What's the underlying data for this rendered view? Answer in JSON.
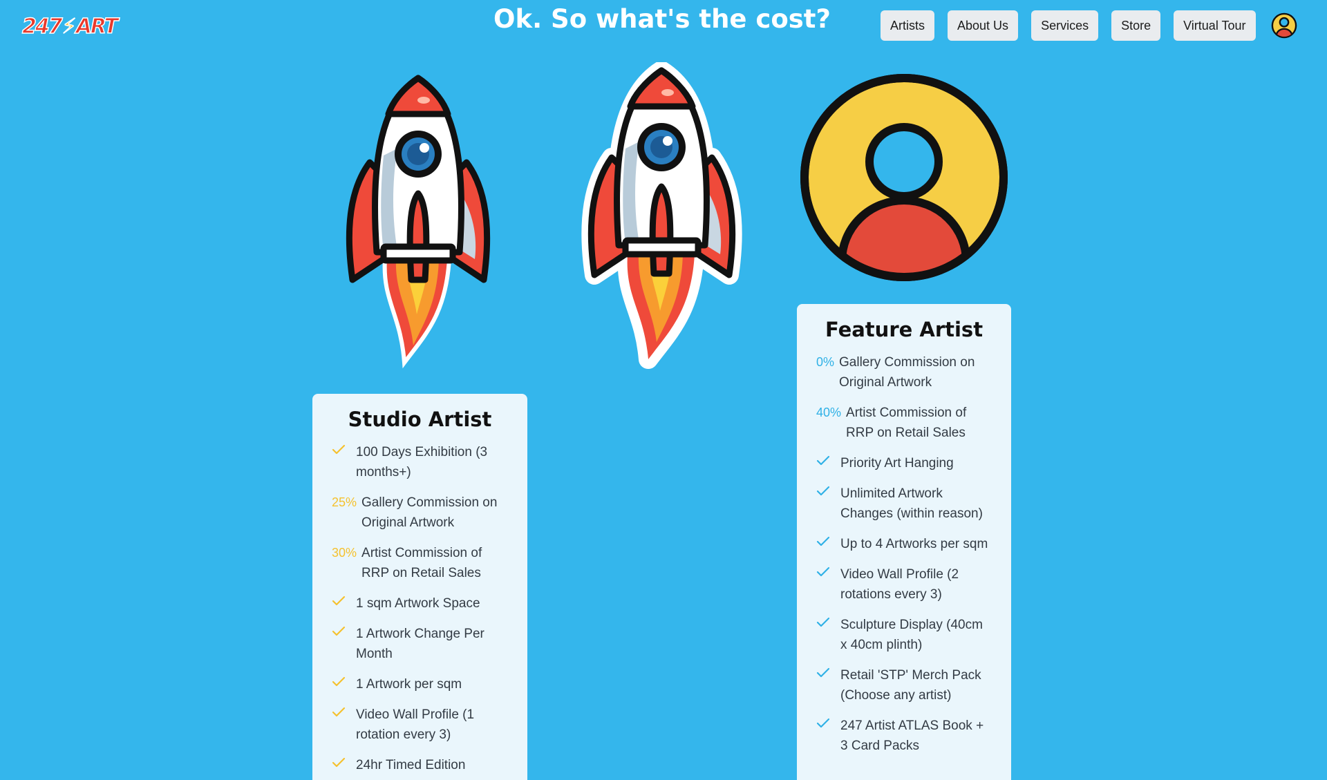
{
  "header": {
    "logo_text_left": "247",
    "logo_text_right": "ART",
    "title": "Ok. So what's the cost?",
    "nav": [
      "Artists",
      "About Us",
      "Services",
      "Store",
      "Virtual Tour"
    ]
  },
  "colors": {
    "background": "#34b6ec",
    "card": "#eaf6fc",
    "studio_accent": "#f5c12e",
    "feature_accent": "#2fb1e6",
    "logo_red": "#e8392b",
    "rocket_red": "#ef4a3a",
    "avatar_yellow": "#f6ce45",
    "avatar_red": "#e34a3a"
  },
  "illustrations": {
    "left": "rocket-icon",
    "middle": "rocket-icon",
    "right": "user-avatar-icon"
  },
  "cards": {
    "studio": {
      "title": "Studio Artist",
      "features": [
        {
          "mark": "check",
          "text": "100 Days Exhibition (3 months+)"
        },
        {
          "mark": "25%",
          "text": "Gallery Commission on Original Artwork"
        },
        {
          "mark": "30%",
          "text": "Artist Commission of RRP on Retail Sales"
        },
        {
          "mark": "check",
          "text": "1 sqm Artwork Space"
        },
        {
          "mark": "check",
          "text": "1 Artwork Change Per Month"
        },
        {
          "mark": "check",
          "text": "1 Artwork per sqm"
        },
        {
          "mark": "check",
          "text": "Video Wall Profile (1 rotation every 3)"
        },
        {
          "mark": "check",
          "text": "24hr Timed Edition"
        }
      ]
    },
    "feature": {
      "title": "Feature Artist",
      "features": [
        {
          "mark": "0%",
          "text": "Gallery Commission on Original Artwork"
        },
        {
          "mark": "40%",
          "text": "Artist Commission of RRP on Retail Sales"
        },
        {
          "mark": "check",
          "text": "Priority Art Hanging"
        },
        {
          "mark": "check",
          "text": "Unlimited Artwork Changes (within reason)"
        },
        {
          "mark": "check",
          "text": "Up to 4 Artworks per sqm"
        },
        {
          "mark": "check",
          "text": "Video Wall Profile (2 rotations every 3)"
        },
        {
          "mark": "check",
          "text": "Sculpture Display (40cm x 40cm plinth)"
        },
        {
          "mark": "check",
          "text": "Retail 'STP' Merch Pack (Choose any artist)"
        },
        {
          "mark": "check",
          "text": "247 Artist ATLAS Book + 3 Card Packs"
        }
      ]
    }
  }
}
